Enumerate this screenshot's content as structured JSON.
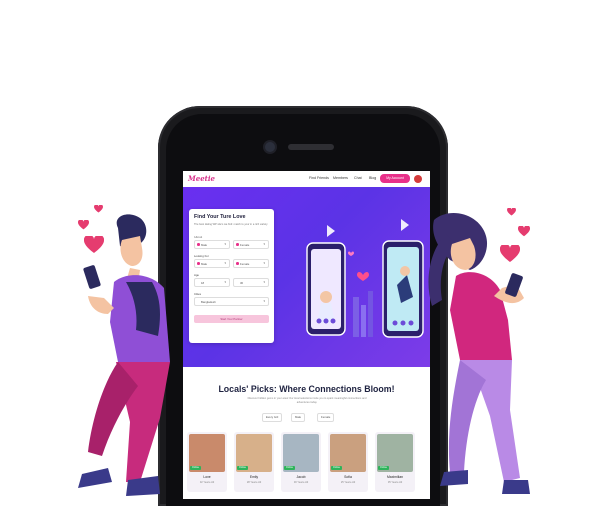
{
  "nav": {
    "logo": "Meetie",
    "links": [
      "Find Friends",
      "Members",
      "Chat",
      "Blog"
    ],
    "account_button": "My Account"
  },
  "search_card": {
    "title": "Find Your Ture Love",
    "subtitle": "The best dating WP site's we find: match to your in a rich variety",
    "i_am_label": "I Am A",
    "i_am_values": [
      "Male",
      "Female"
    ],
    "looking_label": "Looking For",
    "looking_values": [
      "Male",
      "Female"
    ],
    "age_label": "Age",
    "age_values": [
      "18",
      "30"
    ],
    "city_label": "Cities",
    "city_value": "Bangladesh",
    "button": "Start Your Partner"
  },
  "section": {
    "title": "Locals' Picks: Where Connections Bloom!",
    "subtitle": "Discover hidden gems in your area! Our local selections invite you to spark meaningful connections and adventures today.",
    "filters": [
      "Every Girl",
      "Male",
      "Female"
    ]
  },
  "profiles": [
    {
      "name": "Love",
      "age": "32 Years old",
      "status": "Online",
      "color": "#c98a6b"
    },
    {
      "name": "Emily",
      "age": "28 Years old",
      "status": "Online",
      "color": "#d7b08a"
    },
    {
      "name": "Jacob",
      "age": "30 Years old",
      "status": "Online",
      "color": "#a7b6c2"
    },
    {
      "name": "Sofia",
      "age": "25 Years old",
      "status": "Online",
      "color": "#caa07f"
    },
    {
      "name": "Maximilian",
      "age": "35 Years old",
      "status": "Online",
      "color": "#9fb3a2"
    }
  ],
  "colors": {
    "accent": "#e8308a",
    "hero_purple": "#6a2ff0",
    "man_shirt": "#8f4fd6",
    "woman_shirt": "#d1277e",
    "pants_man": "#c72b7d",
    "pants_woman": "#b98ae6"
  }
}
